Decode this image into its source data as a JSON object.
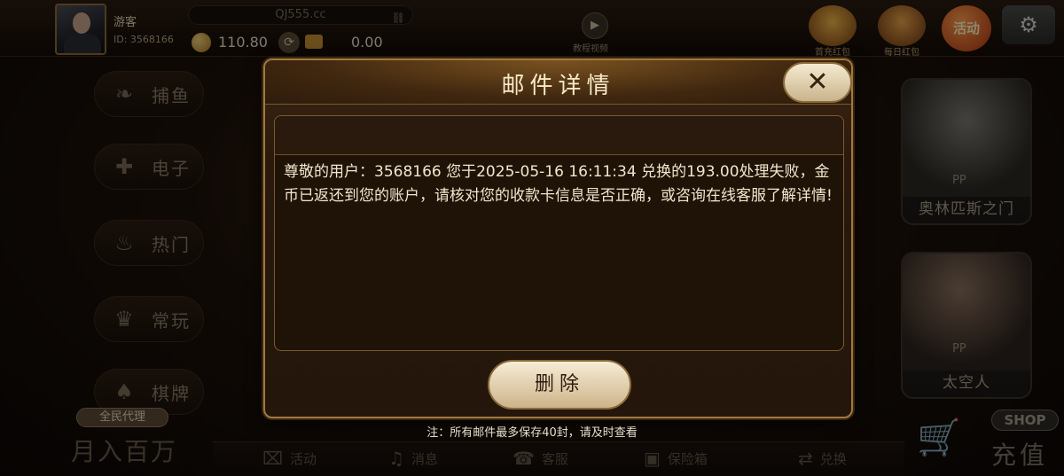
{
  "user": {
    "name": "游客",
    "id_label": "ID: 3568166",
    "balance": "110.80",
    "safe_balance": "0.00"
  },
  "header": {
    "domain": "QJ555.cc",
    "video_label": "教程视频",
    "activity_label": "活动"
  },
  "top_icons": [
    {
      "label": "首充红包"
    },
    {
      "label": "每日红包"
    }
  ],
  "nav": {
    "items": [
      {
        "label": "捕鱼",
        "icon": "fish-icon"
      },
      {
        "label": "电子",
        "icon": "gamepad-icon"
      },
      {
        "label": "热门",
        "icon": "fire-icon"
      },
      {
        "label": "常玩",
        "icon": "crown-icon"
      },
      {
        "label": "棋牌",
        "icon": "cards-icon"
      }
    ],
    "agent_label": "全民代理",
    "agent_slogan": "月入百万"
  },
  "games": [
    {
      "provider": "PP",
      "name": "奥林匹斯之门"
    },
    {
      "provider": "PP",
      "name": "太空人"
    }
  ],
  "shop": {
    "tag": "SHOP",
    "label": "充值"
  },
  "bottom_nav": [
    {
      "label": "活动",
      "icon": "gift-icon"
    },
    {
      "label": "消息",
      "icon": "bell-icon"
    },
    {
      "label": "客服",
      "icon": "headset-icon"
    },
    {
      "label": "保险箱",
      "icon": "safe-icon"
    },
    {
      "label": "兑换",
      "icon": "exchange-icon"
    }
  ],
  "modal": {
    "title": "邮件详情",
    "message": "尊敬的用户：3568166 您于2025-05-16 16:11:34  兑换的193.00处理失败，金币已返还到您的账户，请核对您的收款卡信息是否正确，或咨询在线客服了解详情!",
    "delete_label": "删除",
    "note": "注：所有邮件最多保存40封，请及时查看"
  },
  "colors": {
    "accent_gold": "#a07a3d",
    "button_cream": "#f6ecd6",
    "panel_dark": "#1f1308"
  }
}
